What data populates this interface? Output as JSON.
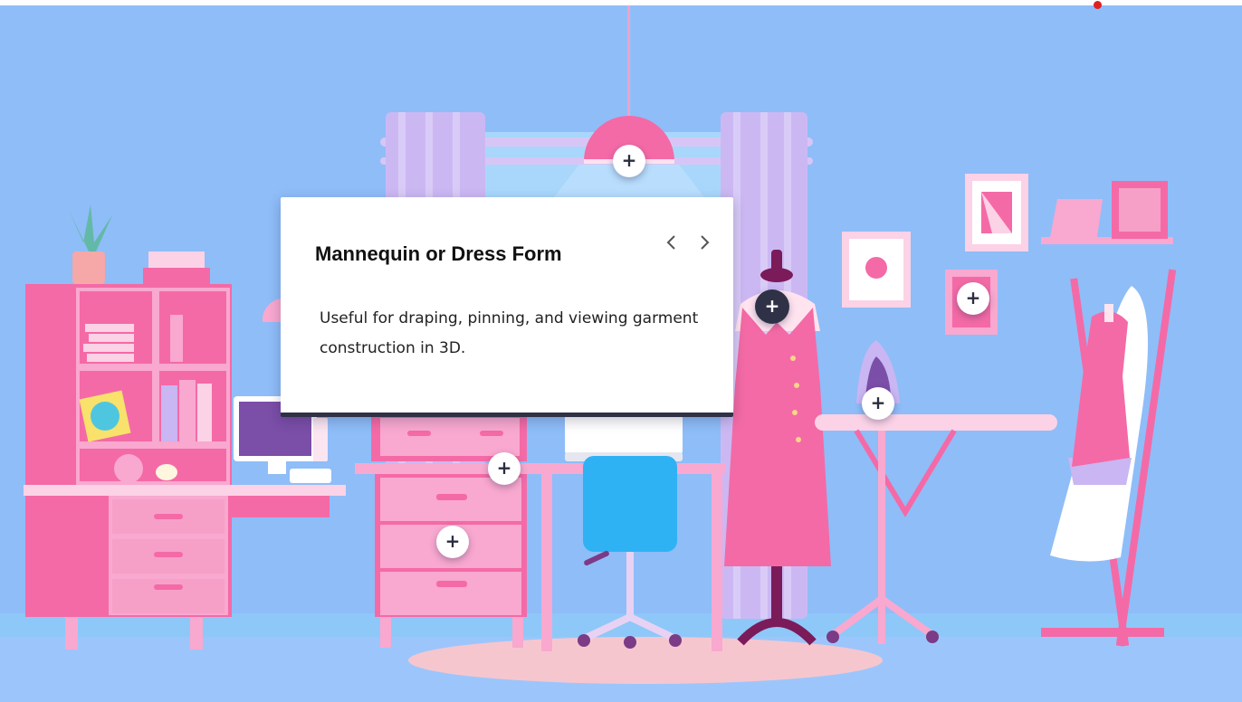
{
  "popup": {
    "title": "Mannequin or Dress Form",
    "description": "Useful for draping, pinning, and viewing garment construction in 3D.",
    "prev_icon": "chevron-left-icon",
    "next_icon": "chevron-right-icon"
  },
  "hotspots": [
    {
      "id": "lamp",
      "symbol": "+",
      "active": false
    },
    {
      "id": "mannequin",
      "symbol": "+",
      "active": true
    },
    {
      "id": "wall-frame",
      "symbol": "+",
      "active": false
    },
    {
      "id": "iron",
      "symbol": "+",
      "active": false
    },
    {
      "id": "desk",
      "symbol": "+",
      "active": false
    },
    {
      "id": "drawer",
      "symbol": "+",
      "active": false
    }
  ],
  "colors": {
    "background": "#8fbdf8",
    "pink": "#f7679f",
    "light_pink": "#f9a8cf",
    "lavender": "#c9b6f2",
    "chair_blue": "#2fb2f4",
    "rug": "#f6c6cf",
    "popup_border": "#2f3246",
    "indicator": "#e02020"
  }
}
